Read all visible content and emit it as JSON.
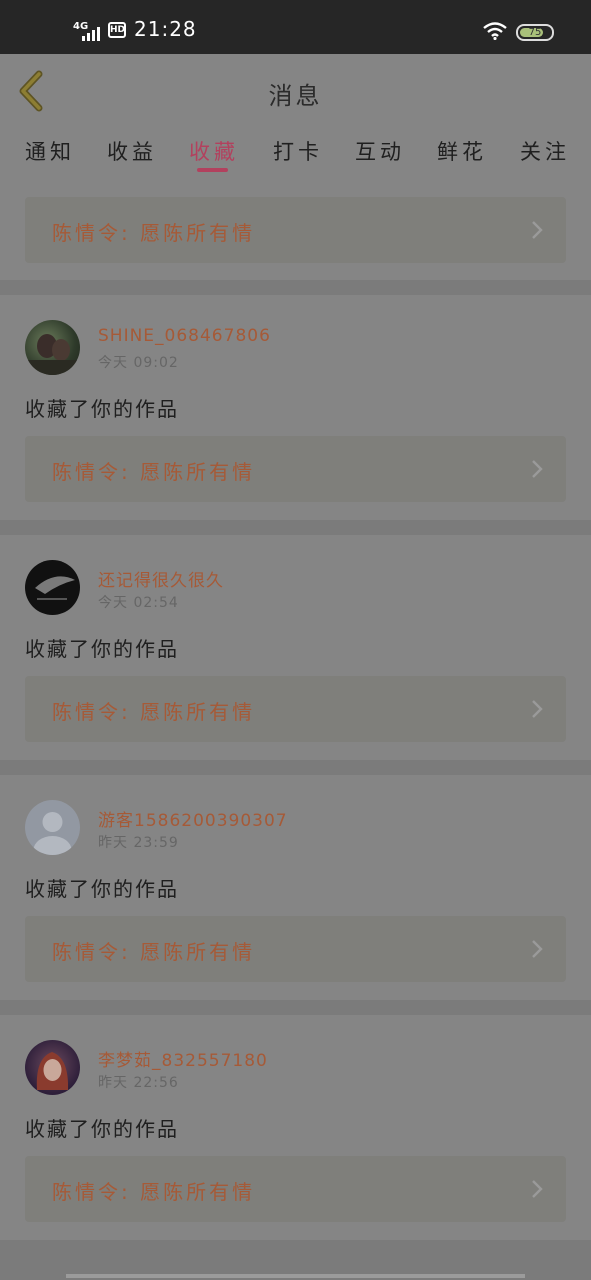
{
  "status_bar": {
    "network": "4G",
    "hd": "HD",
    "time": "21:28",
    "battery": "75"
  },
  "header": {
    "title": "消息"
  },
  "tabs": [
    {
      "label": "通知"
    },
    {
      "label": "收益"
    },
    {
      "label": "收藏",
      "active": true
    },
    {
      "label": "打卡"
    },
    {
      "label": "互动"
    },
    {
      "label": "鲜花"
    },
    {
      "label": "关注"
    }
  ],
  "first_work": {
    "title": "陈情令: 愿陈所有情"
  },
  "items": [
    {
      "username": "SHINE_068467806",
      "time": "今天 09:02",
      "action": "收藏了你的作品",
      "work_title": "陈情令: 愿陈所有情",
      "avatar": "photo-avatar"
    },
    {
      "username": "还记得很久很久",
      "time": "今天 02:54",
      "action": "收藏了你的作品",
      "work_title": "陈情令: 愿陈所有情",
      "avatar": "dark-avatar"
    },
    {
      "username": "游客1586200390307",
      "time": "昨天 23:59",
      "action": "收藏了你的作品",
      "work_title": "陈情令: 愿陈所有情",
      "avatar": "default-avatar"
    },
    {
      "username": "李梦茹_832557180",
      "time": "昨天 22:56",
      "action": "收藏了你的作品",
      "work_title": "陈情令: 愿陈所有情",
      "avatar": "anime-avatar"
    }
  ],
  "colors": {
    "accent": "#b2415e",
    "username": "#a65a37",
    "overlay_bg": "#858585"
  }
}
